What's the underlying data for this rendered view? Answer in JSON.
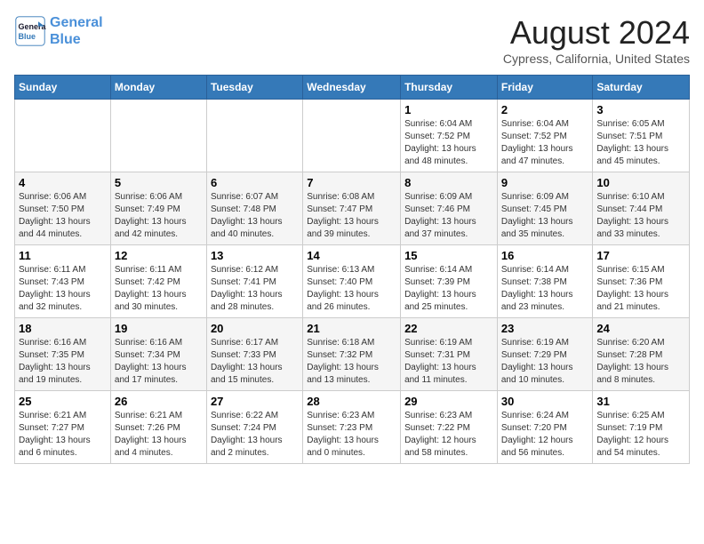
{
  "header": {
    "logo_line1": "General",
    "logo_line2": "Blue",
    "month_year": "August 2024",
    "location": "Cypress, California, United States"
  },
  "weekdays": [
    "Sunday",
    "Monday",
    "Tuesday",
    "Wednesday",
    "Thursday",
    "Friday",
    "Saturday"
  ],
  "weeks": [
    [
      {
        "day": "",
        "info": ""
      },
      {
        "day": "",
        "info": ""
      },
      {
        "day": "",
        "info": ""
      },
      {
        "day": "",
        "info": ""
      },
      {
        "day": "1",
        "info": "Sunrise: 6:04 AM\nSunset: 7:52 PM\nDaylight: 13 hours\nand 48 minutes."
      },
      {
        "day": "2",
        "info": "Sunrise: 6:04 AM\nSunset: 7:52 PM\nDaylight: 13 hours\nand 47 minutes."
      },
      {
        "day": "3",
        "info": "Sunrise: 6:05 AM\nSunset: 7:51 PM\nDaylight: 13 hours\nand 45 minutes."
      }
    ],
    [
      {
        "day": "4",
        "info": "Sunrise: 6:06 AM\nSunset: 7:50 PM\nDaylight: 13 hours\nand 44 minutes."
      },
      {
        "day": "5",
        "info": "Sunrise: 6:06 AM\nSunset: 7:49 PM\nDaylight: 13 hours\nand 42 minutes."
      },
      {
        "day": "6",
        "info": "Sunrise: 6:07 AM\nSunset: 7:48 PM\nDaylight: 13 hours\nand 40 minutes."
      },
      {
        "day": "7",
        "info": "Sunrise: 6:08 AM\nSunset: 7:47 PM\nDaylight: 13 hours\nand 39 minutes."
      },
      {
        "day": "8",
        "info": "Sunrise: 6:09 AM\nSunset: 7:46 PM\nDaylight: 13 hours\nand 37 minutes."
      },
      {
        "day": "9",
        "info": "Sunrise: 6:09 AM\nSunset: 7:45 PM\nDaylight: 13 hours\nand 35 minutes."
      },
      {
        "day": "10",
        "info": "Sunrise: 6:10 AM\nSunset: 7:44 PM\nDaylight: 13 hours\nand 33 minutes."
      }
    ],
    [
      {
        "day": "11",
        "info": "Sunrise: 6:11 AM\nSunset: 7:43 PM\nDaylight: 13 hours\nand 32 minutes."
      },
      {
        "day": "12",
        "info": "Sunrise: 6:11 AM\nSunset: 7:42 PM\nDaylight: 13 hours\nand 30 minutes."
      },
      {
        "day": "13",
        "info": "Sunrise: 6:12 AM\nSunset: 7:41 PM\nDaylight: 13 hours\nand 28 minutes."
      },
      {
        "day": "14",
        "info": "Sunrise: 6:13 AM\nSunset: 7:40 PM\nDaylight: 13 hours\nand 26 minutes."
      },
      {
        "day": "15",
        "info": "Sunrise: 6:14 AM\nSunset: 7:39 PM\nDaylight: 13 hours\nand 25 minutes."
      },
      {
        "day": "16",
        "info": "Sunrise: 6:14 AM\nSunset: 7:38 PM\nDaylight: 13 hours\nand 23 minutes."
      },
      {
        "day": "17",
        "info": "Sunrise: 6:15 AM\nSunset: 7:36 PM\nDaylight: 13 hours\nand 21 minutes."
      }
    ],
    [
      {
        "day": "18",
        "info": "Sunrise: 6:16 AM\nSunset: 7:35 PM\nDaylight: 13 hours\nand 19 minutes."
      },
      {
        "day": "19",
        "info": "Sunrise: 6:16 AM\nSunset: 7:34 PM\nDaylight: 13 hours\nand 17 minutes."
      },
      {
        "day": "20",
        "info": "Sunrise: 6:17 AM\nSunset: 7:33 PM\nDaylight: 13 hours\nand 15 minutes."
      },
      {
        "day": "21",
        "info": "Sunrise: 6:18 AM\nSunset: 7:32 PM\nDaylight: 13 hours\nand 13 minutes."
      },
      {
        "day": "22",
        "info": "Sunrise: 6:19 AM\nSunset: 7:31 PM\nDaylight: 13 hours\nand 11 minutes."
      },
      {
        "day": "23",
        "info": "Sunrise: 6:19 AM\nSunset: 7:29 PM\nDaylight: 13 hours\nand 10 minutes."
      },
      {
        "day": "24",
        "info": "Sunrise: 6:20 AM\nSunset: 7:28 PM\nDaylight: 13 hours\nand 8 minutes."
      }
    ],
    [
      {
        "day": "25",
        "info": "Sunrise: 6:21 AM\nSunset: 7:27 PM\nDaylight: 13 hours\nand 6 minutes."
      },
      {
        "day": "26",
        "info": "Sunrise: 6:21 AM\nSunset: 7:26 PM\nDaylight: 13 hours\nand 4 minutes."
      },
      {
        "day": "27",
        "info": "Sunrise: 6:22 AM\nSunset: 7:24 PM\nDaylight: 13 hours\nand 2 minutes."
      },
      {
        "day": "28",
        "info": "Sunrise: 6:23 AM\nSunset: 7:23 PM\nDaylight: 13 hours\nand 0 minutes."
      },
      {
        "day": "29",
        "info": "Sunrise: 6:23 AM\nSunset: 7:22 PM\nDaylight: 12 hours\nand 58 minutes."
      },
      {
        "day": "30",
        "info": "Sunrise: 6:24 AM\nSunset: 7:20 PM\nDaylight: 12 hours\nand 56 minutes."
      },
      {
        "day": "31",
        "info": "Sunrise: 6:25 AM\nSunset: 7:19 PM\nDaylight: 12 hours\nand 54 minutes."
      }
    ]
  ]
}
